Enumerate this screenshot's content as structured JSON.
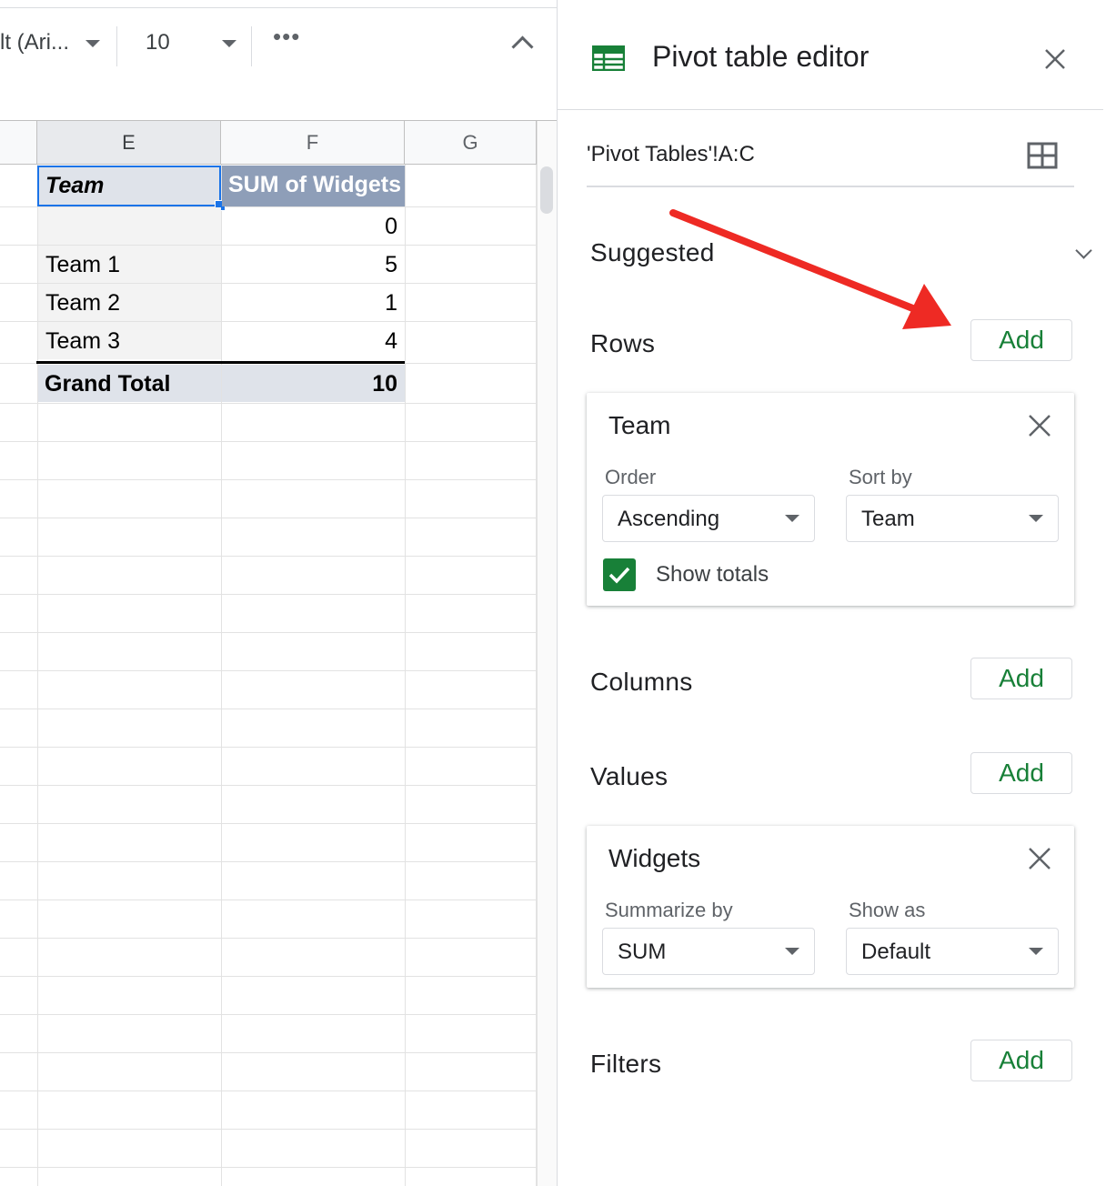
{
  "toolbar": {
    "font_name": "lt (Ari...",
    "font_size": "10",
    "more_icon": "more-horizontal",
    "collapse_icon": "chevron-up"
  },
  "sheet": {
    "columns": [
      "E",
      "F",
      "G"
    ],
    "selected_column": "E",
    "pivot": {
      "header_label": "Team",
      "header_value": "SUM of Widgets",
      "rows": [
        {
          "label": "",
          "value": "0"
        },
        {
          "label": "Team 1",
          "value": "5"
        },
        {
          "label": "Team 2",
          "value": "1"
        },
        {
          "label": "Team 3",
          "value": "4"
        }
      ],
      "total_label": "Grand Total",
      "total_value": "10"
    },
    "header_fill": "#8e9eb8",
    "selection_color": "#1a73e8"
  },
  "panel": {
    "title": "Pivot table editor",
    "range": "'Pivot Tables'!A:C",
    "suggested_label": "Suggested",
    "rows": {
      "label": "Rows",
      "add_label": "Add",
      "field": {
        "name": "Team",
        "order_label": "Order",
        "order_value": "Ascending",
        "sort_label": "Sort by",
        "sort_value": "Team",
        "show_totals_label": "Show totals",
        "show_totals_checked": true
      }
    },
    "columns": {
      "label": "Columns",
      "add_label": "Add"
    },
    "values": {
      "label": "Values",
      "add_label": "Add",
      "field": {
        "name": "Widgets",
        "summarize_label": "Summarize by",
        "summarize_value": "SUM",
        "show_as_label": "Show as",
        "show_as_value": "Default"
      }
    },
    "filters": {
      "label": "Filters",
      "add_label": "Add"
    },
    "accent_color": "#188038",
    "annotation_arrow_color": "#ee2a24"
  }
}
